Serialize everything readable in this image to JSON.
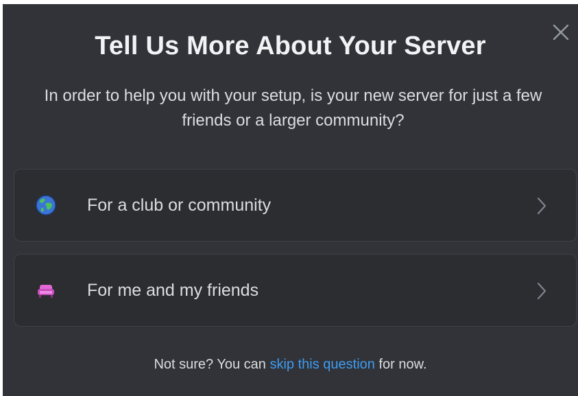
{
  "modal": {
    "title": "Tell Us More About Your Server",
    "subtitle": "In order to help you with your setup, is your new server for just a few friends or a larger community?",
    "close_icon": "close-icon"
  },
  "options": [
    {
      "label": "For a club or community",
      "icon": "globe-icon",
      "chevron": "chevron-right-icon"
    },
    {
      "label": "For me and my friends",
      "icon": "couch-icon",
      "chevron": "chevron-right-icon"
    }
  ],
  "footer": {
    "prefix": "Not sure? You can ",
    "link": "skip this question",
    "suffix": " for now."
  },
  "colors": {
    "background": "#313338",
    "card": "#2b2d31",
    "link": "#3e9cf2",
    "heading": "#f2f3f5"
  }
}
